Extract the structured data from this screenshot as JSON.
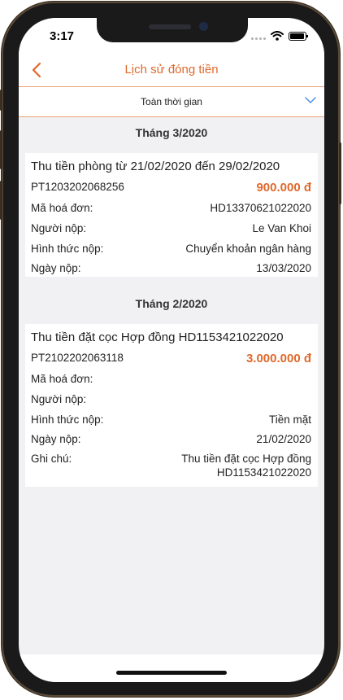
{
  "status_bar": {
    "time": "3:17"
  },
  "nav": {
    "title": "Lịch sử đóng tiền"
  },
  "filter": {
    "label": "Toàn thời gian"
  },
  "sections": [
    {
      "header": "Tháng 3/2020",
      "card": {
        "title": "Thu tiền phòng từ 21/02/2020 đến 29/02/2020",
        "code": "PT1203202068256",
        "amount": "900.000 đ",
        "invoice_label": "Mã hoá đơn:",
        "invoice_value": "HD13370621022020",
        "payer_label": "Người nộp:",
        "payer_value": "Le Van Khoi",
        "method_label": "Hình thức nộp:",
        "method_value": "Chuyển khoản ngân hàng",
        "date_label": "Ngày nộp:",
        "date_value": "13/03/2020"
      }
    },
    {
      "header": "Tháng 2/2020",
      "card": {
        "title": "Thu tiền đặt cọc Hợp đồng HD1153421022020",
        "code": "PT2102202063118",
        "amount": "3.000.000 đ",
        "invoice_label": "Mã hoá đơn:",
        "invoice_value": "",
        "payer_label": "Người nộp:",
        "payer_value": "",
        "method_label": "Hình thức nộp:",
        "method_value": "Tiền mặt",
        "date_label": "Ngày nộp:",
        "date_value": "21/02/2020",
        "note_label": "Ghi chú:",
        "note_line1": "Thu tiền đặt cọc Hợp đồng",
        "note_line2": "HD1153421022020"
      }
    }
  ],
  "colors": {
    "accent": "#e0682a",
    "divider": "#e8a27a",
    "background": "#f1f1f4"
  }
}
